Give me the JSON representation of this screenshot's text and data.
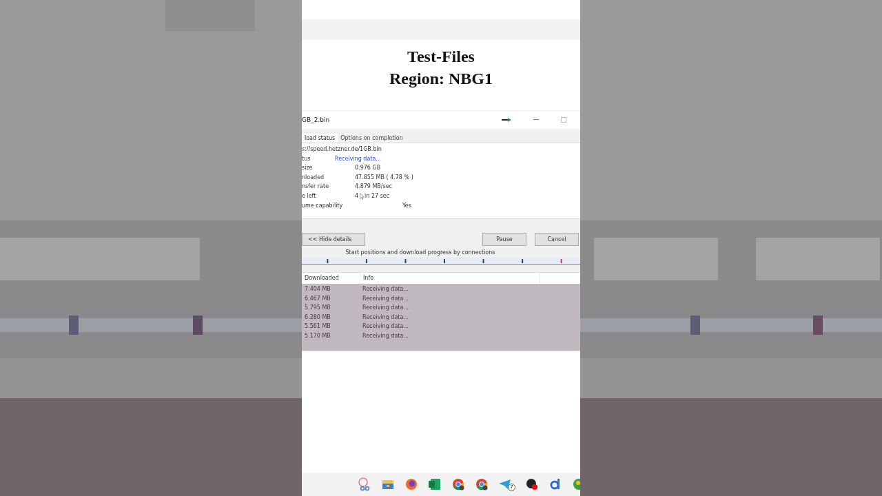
{
  "heading": {
    "line_1": "Test-Files",
    "line_2": "Region: NBG1"
  },
  "window": {
    "title": "GB_2.bin"
  },
  "tabs": [
    {
      "label": "load status",
      "selected": true
    },
    {
      "label": "Options on completion",
      "selected": false
    }
  ],
  "url": "s://speed.hetzner.de/1GB.bin",
  "details": [
    {
      "label": "tus",
      "value": "Receiving data...",
      "kind": "status"
    },
    {
      "label": "size",
      "value": "0.976  GB",
      "kind": "plain"
    },
    {
      "label": "nloaded",
      "value": "47.855  MB  ( 4.78 % )",
      "kind": "plain"
    },
    {
      "label": "nsfer rate",
      "value": "4.879  MB/sec",
      "kind": "plain"
    },
    {
      "label": "e left",
      "value": "4",
      "value_rest": "in 27 sec",
      "kind": "cursor"
    },
    {
      "label": "ume capability",
      "value": "Yes",
      "kind": "far"
    }
  ],
  "buttons": {
    "hide": "<< Hide details",
    "pause": "Pause",
    "cancel": "Cancel"
  },
  "connections_label": "Start positions and download progress by connections",
  "table": {
    "columns": [
      "Downloaded",
      "Info"
    ],
    "rows": [
      [
        "7.404  MB",
        "Receiving data..."
      ],
      [
        "6.467  MB",
        "Receiving data..."
      ],
      [
        "5.795  MB",
        "Receiving data..."
      ],
      [
        "6.280  MB",
        "Receiving data..."
      ],
      [
        "5.561  MB",
        "Receiving data..."
      ],
      [
        "5.170  MB",
        "Receiving data..."
      ]
    ]
  },
  "taskbar": [
    {
      "kind": "scissors"
    },
    {
      "kind": "folder"
    },
    {
      "kind": "fox"
    },
    {
      "kind": "sheet"
    },
    {
      "kind": "chrome"
    },
    {
      "kind": "chrome"
    },
    {
      "kind": "plane",
      "badge": "7"
    },
    {
      "kind": "record"
    },
    {
      "kind": "d"
    },
    {
      "kind": "green"
    }
  ]
}
